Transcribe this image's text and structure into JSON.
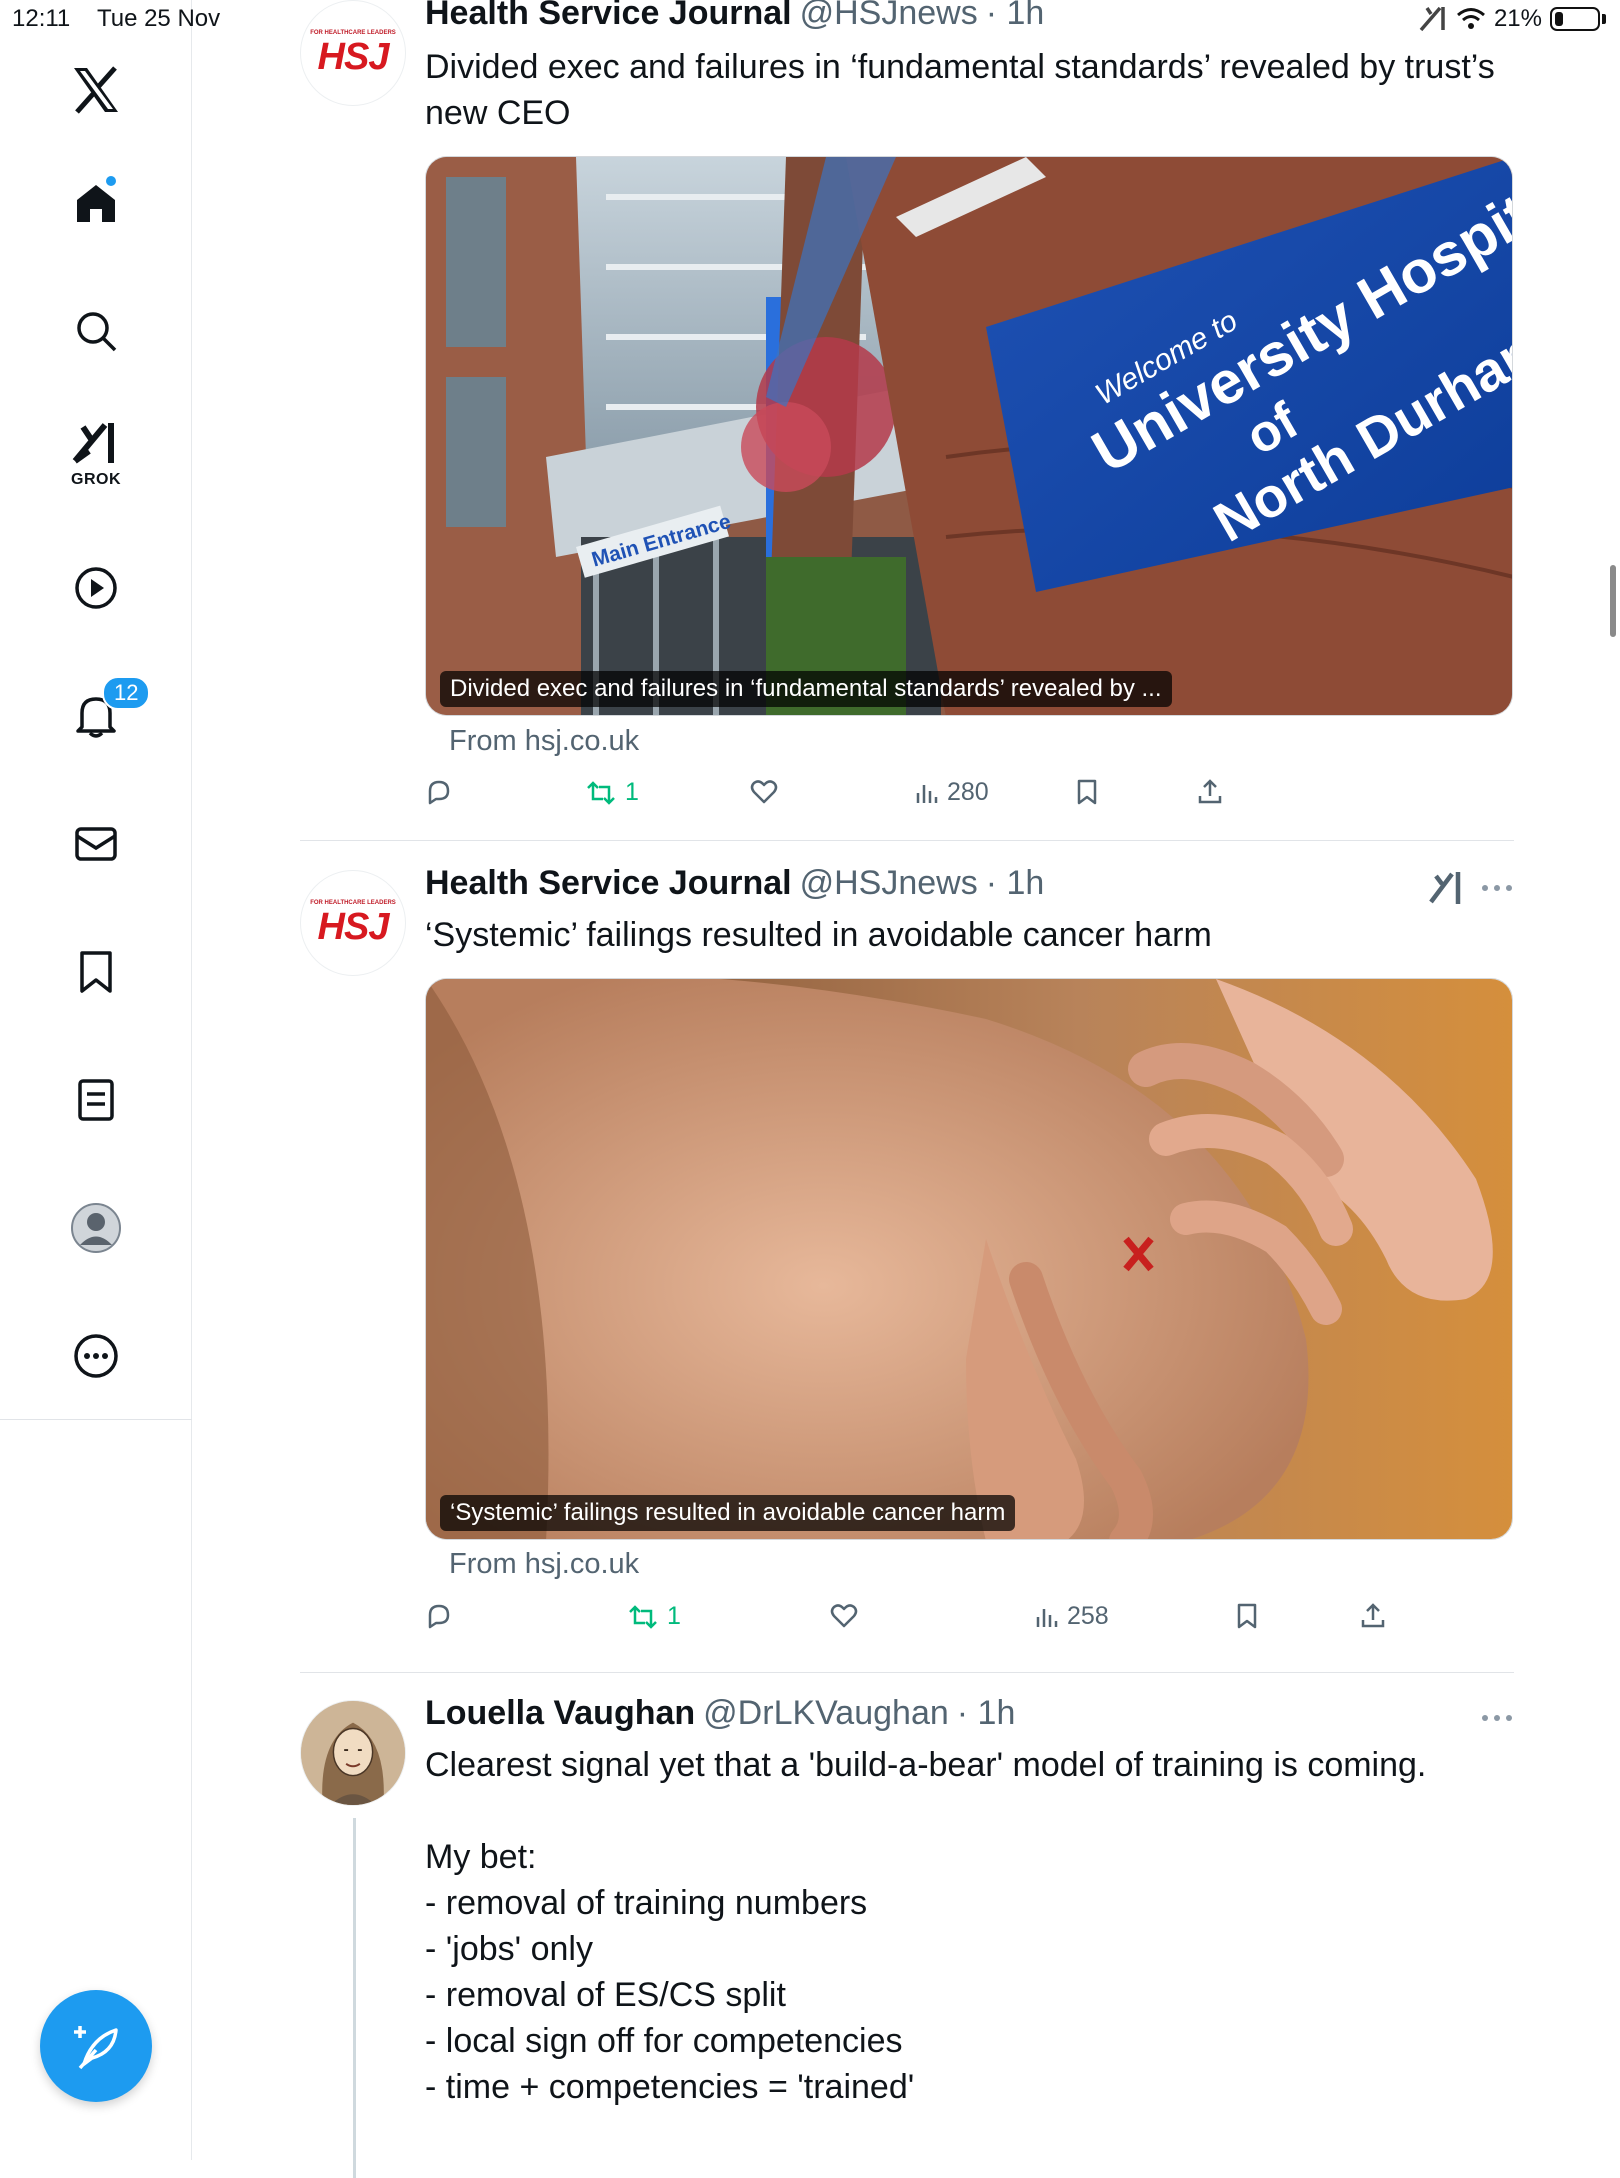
{
  "status_bar": {
    "time": "12:11",
    "date": "Tue 25 Nov",
    "battery": "21%",
    "battery_level": 0.21
  },
  "sidebar": {
    "items": [
      {
        "name": "x-logo"
      },
      {
        "name": "home"
      },
      {
        "name": "search"
      },
      {
        "name": "grok",
        "label": "GROK"
      },
      {
        "name": "video"
      },
      {
        "name": "notifications",
        "badge": "12"
      },
      {
        "name": "messages"
      },
      {
        "name": "bookmarks"
      },
      {
        "name": "lists"
      },
      {
        "name": "profile"
      },
      {
        "name": "more"
      }
    ]
  },
  "posts": [
    {
      "author": "Health Service Journal",
      "handle": "@HSJnews",
      "time": "· 1h",
      "avatar_label": "HSJ",
      "avatar_tagline": "FOR HEALTHCARE LEADERS",
      "text": "Divided exec and failures in ‘fundamental standards’ revealed by trust’s new CEO",
      "media_caption": "Divided exec and failures in ‘fundamental standards’ revealed by ...",
      "media_text": {
        "welcome": "Welcome to",
        "line1": "University Hospital",
        "line2": "of",
        "line3": "North Durham",
        "entrance": "Main Entrance"
      },
      "link_source": "From hsj.co.uk",
      "replies": "",
      "reposts": "1",
      "likes": "",
      "views": "280"
    },
    {
      "author": "Health Service Journal",
      "handle": "@HSJnews",
      "time": "· 1h",
      "avatar_label": "HSJ",
      "avatar_tagline": "FOR HEALTHCARE LEADERS",
      "text": "‘Systemic’ failings resulted in avoidable cancer harm",
      "media_caption": "‘Systemic’ failings resulted in avoidable cancer harm",
      "link_source": "From hsj.co.uk",
      "replies": "",
      "reposts": "1",
      "likes": "",
      "views": "258"
    },
    {
      "author": "Louella Vaughan",
      "handle": "@DrLKVaughan",
      "time": "· 1h",
      "text": "Clearest signal yet that a 'build-a-bear' model of training is coming.\n\nMy bet:\n- removal of training numbers\n- 'jobs' only\n- removal of ES/CS split\n- local sign off for competencies\n- time + competencies = 'trained'"
    }
  ],
  "colors": {
    "accent": "#1d9bf0",
    "repost": "#00ba7c",
    "secondary_text": "#536471",
    "hsj_red": "#d71920"
  }
}
